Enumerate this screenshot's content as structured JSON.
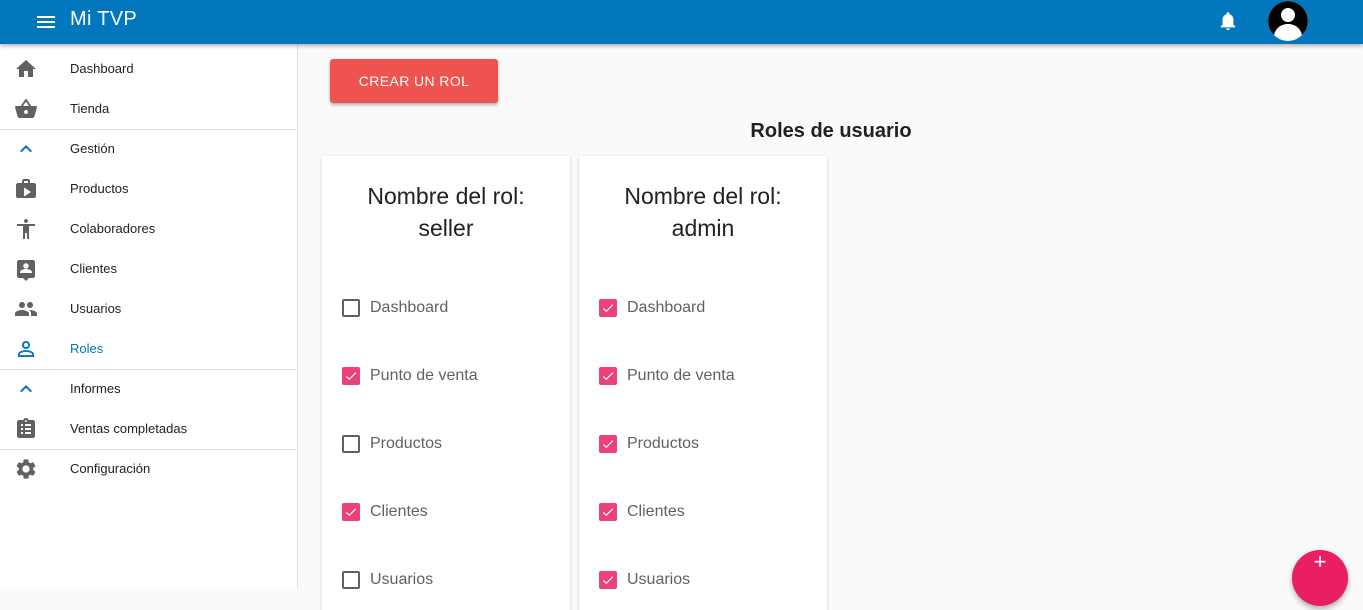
{
  "app": {
    "title": "Mi TVP"
  },
  "topbar": {
    "menu_icon": "menu-icon",
    "notifications_icon": "bell-icon",
    "avatar_icon": "account-circle-icon"
  },
  "sidebar": {
    "items": [
      {
        "label": "Dashboard",
        "icon": "home-icon"
      },
      {
        "label": "Tienda",
        "icon": "shopping-basket-icon"
      },
      {
        "label": "Gestión",
        "icon": "chevron-up-icon"
      },
      {
        "label": "Productos",
        "icon": "work-icon"
      },
      {
        "label": "Colaboradores",
        "icon": "accessibility-icon"
      },
      {
        "label": "Clientes",
        "icon": "contact-icon"
      },
      {
        "label": "Usuarios",
        "icon": "people-icon"
      },
      {
        "label": "Roles",
        "icon": "person-icon",
        "active": true
      },
      {
        "label": "Informes",
        "icon": "chevron-up-icon"
      },
      {
        "label": "Ventas completadas",
        "icon": "assignment-icon"
      },
      {
        "label": "Configuración",
        "icon": "settings-icon"
      }
    ]
  },
  "main": {
    "create_button": "CREAR UN ROL",
    "title": "Roles de usuario",
    "roles": [
      {
        "line1": "Nombre del rol:",
        "line2": "seller",
        "permissions": [
          {
            "label": "Dashboard",
            "checked": false
          },
          {
            "label": "Punto de venta",
            "checked": true
          },
          {
            "label": "Productos",
            "checked": false
          },
          {
            "label": "Clientes",
            "checked": true
          },
          {
            "label": "Usuarios",
            "checked": false
          }
        ]
      },
      {
        "line1": "Nombre del rol:",
        "line2": "admin",
        "permissions": [
          {
            "label": "Dashboard",
            "checked": true
          },
          {
            "label": "Punto de venta",
            "checked": true
          },
          {
            "label": "Productos",
            "checked": true
          },
          {
            "label": "Clientes",
            "checked": true
          },
          {
            "label": "Usuarios",
            "checked": true
          }
        ]
      }
    ]
  },
  "fab": {
    "icon": "plus-icon",
    "label": "+"
  },
  "colors": {
    "primary": "#0277bd",
    "accent": "#ec407a",
    "create_button": "#ef5350",
    "fab": "#e91e63"
  }
}
